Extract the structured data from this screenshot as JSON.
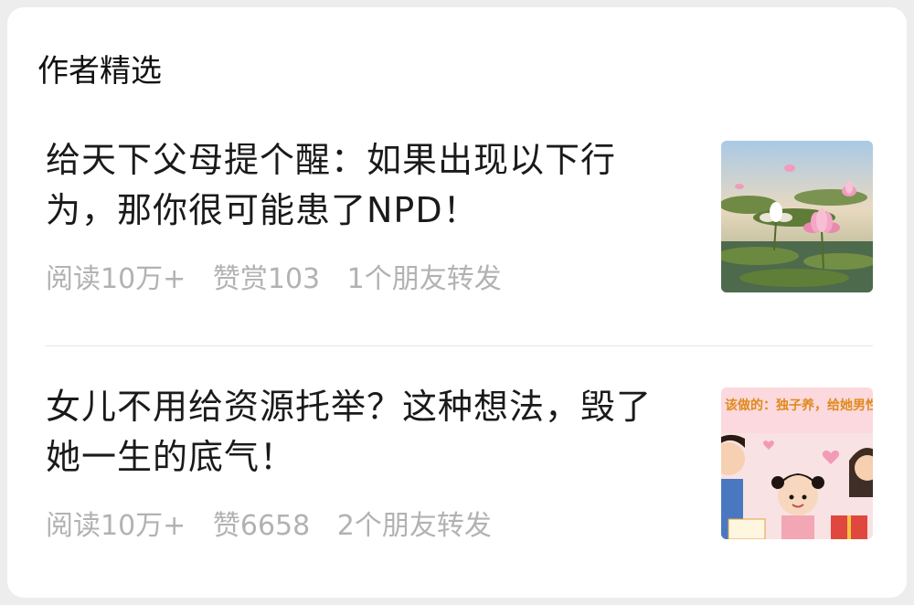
{
  "section": {
    "title": "作者精选"
  },
  "articles": [
    {
      "title": "给天下父母提个醒：如果出现以下行为，那你很可能患了NPD！",
      "reads": "阅读10万+",
      "likes": "赞赏103",
      "shares": "1个朋友转发",
      "thumbnail": "lotus-pond-image"
    },
    {
      "title": "女儿不用给资源托举？这种想法，毁了她一生的底气！",
      "reads": "阅读10万+",
      "likes": "赞6658",
      "shares": "2个朋友转发",
      "thumbnail": "family-cartoon-image",
      "thumbnail_text": "该做的：独子养，给她男性专属资"
    }
  ]
}
